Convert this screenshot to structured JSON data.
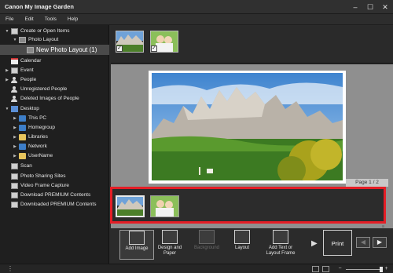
{
  "window": {
    "title": "Canon My Image Garden",
    "minimize_glyph": "–",
    "maximize_glyph": "☐",
    "close_glyph": "✕"
  },
  "menu": [
    "File",
    "Edit",
    "Tools",
    "Help"
  ],
  "sidebar": {
    "items": [
      {
        "label": "Create or Open Items",
        "icon": "create-items-icon",
        "expanded": true
      },
      {
        "label": "Photo Layout",
        "icon": "photo-layout-folder-icon",
        "expanded": true
      },
      {
        "label": "New Photo Layout (1)",
        "icon": "layout-item-icon",
        "selected": true
      },
      {
        "label": "Calendar",
        "icon": "calendar-icon"
      },
      {
        "label": "Event",
        "icon": "event-icon"
      },
      {
        "label": "People",
        "icon": "people-icon"
      },
      {
        "label": "Unregistered People",
        "icon": "unregistered-people-icon"
      },
      {
        "label": "Deleted Images of People",
        "icon": "deleted-people-icon"
      },
      {
        "label": "Desktop",
        "icon": "desktop-icon",
        "expanded": true
      },
      {
        "label": "This PC",
        "icon": "this-pc-icon"
      },
      {
        "label": "Homegroup",
        "icon": "homegroup-icon"
      },
      {
        "label": "Libraries",
        "icon": "libraries-icon"
      },
      {
        "label": "Network",
        "icon": "network-icon"
      },
      {
        "label": "UserName",
        "icon": "user-folder-icon"
      },
      {
        "label": "Scan",
        "icon": "scan-icon"
      },
      {
        "label": "Photo Sharing Sites",
        "icon": "photo-sharing-icon"
      },
      {
        "label": "Video Frame Capture",
        "icon": "video-capture-icon"
      },
      {
        "label": "Download PREMIUM Contents",
        "icon": "download-premium-icon"
      },
      {
        "label": "Downloaded PREMIUM Contents",
        "icon": "downloaded-premium-icon"
      }
    ]
  },
  "preview": {
    "page_indicator": "Page 1 / 2",
    "check_glyph": "✓"
  },
  "toolbar": {
    "add_image": "Add Image",
    "design_paper": "Design and Paper",
    "background": "Background",
    "layout": "Layout",
    "add_text": "Add Text or Layout Frame",
    "print": "Print",
    "more_glyph": "▶",
    "prev_glyph": "◀",
    "next_glyph": "▶"
  },
  "statusbar": {
    "menu_glyph": "⋮",
    "zoom_out": "−",
    "zoom_in": "+",
    "zoom_level": 1.0
  },
  "colors": {
    "highlight": "#e41e26",
    "background": "#2b2b2b",
    "canvas": "#8f8f8f"
  }
}
